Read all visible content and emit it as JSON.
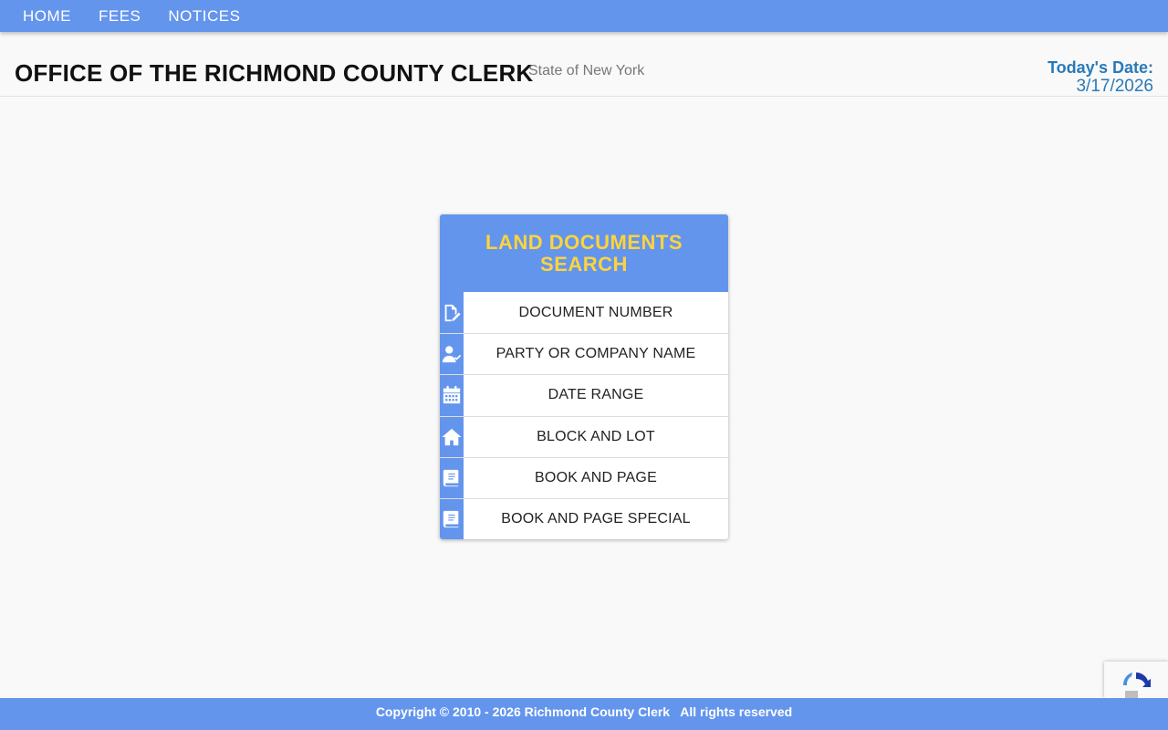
{
  "nav": {
    "items": [
      {
        "label": "HOME"
      },
      {
        "label": "FEES"
      },
      {
        "label": "NOTICES"
      }
    ]
  },
  "header": {
    "title": "OFFICE OF THE RICHMOND COUNTY CLERK",
    "subtitle": "State of New York",
    "date_label": "Today's Date:",
    "date_value": "3/17/2026"
  },
  "search_card": {
    "title": "LAND DOCUMENTS SEARCH",
    "items": [
      {
        "label": "DOCUMENT NUMBER",
        "icon": "document-edit-icon"
      },
      {
        "label": "PARTY OR COMPANY NAME",
        "icon": "user-check-icon"
      },
      {
        "label": "DATE RANGE",
        "icon": "calendar-icon"
      },
      {
        "label": "BLOCK AND LOT",
        "icon": "home-icon"
      },
      {
        "label": "BOOK AND PAGE",
        "icon": "book-icon"
      },
      {
        "label": "BOOK AND PAGE SPECIAL",
        "icon": "book-icon"
      }
    ]
  },
  "footer": {
    "copyright": "Copyright © 2010 - 2026 Richmond County Clerk   All rights reserved"
  },
  "colors": {
    "primary": "#6495ed",
    "accent": "#ffd43b",
    "date_text": "#2a7ab8"
  }
}
